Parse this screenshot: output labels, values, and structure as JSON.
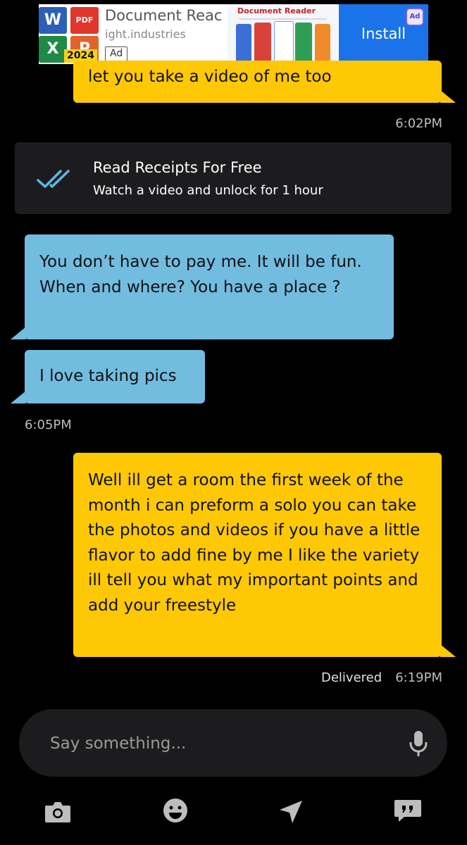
{
  "ad": {
    "title": "Document Reac",
    "domain": "ight.industries",
    "year_badge": "2024",
    "ad_label": "Ad",
    "screenshot_title": "Document Reader",
    "install_label": "Install",
    "badge_text": "Ad",
    "tile_labels": [
      "W",
      "PDF",
      "X",
      "P"
    ]
  },
  "messages": {
    "m1_text": "let you take a video of me too",
    "m1_time": "6:02PM",
    "m2_text": "You don’t have to pay me. It will be fun. When and where? You have a place ?",
    "m3_text": "I love taking pics",
    "m3_time": "6:05PM",
    "m4_text": "Well ill get a room the first week of the month i can preform a solo you can take the photos and videos if you have a little flavor to add fine by me I like the variety ill tell you what my important points and add your freestyle",
    "m4_status": "Delivered",
    "m4_time": "6:19PM"
  },
  "receipts_card": {
    "title": "Read Receipts For Free",
    "subtitle": "Watch a video and unlock for 1 hour",
    "icon": "double-check-icon"
  },
  "composer": {
    "placeholder": "Say something..."
  },
  "toolbar_icons": [
    "camera-icon",
    "emoji-icon",
    "location-icon",
    "phrases-icon"
  ],
  "colors": {
    "outgoing_bubble": "#fec804",
    "incoming_bubble": "#72bce0",
    "background": "#000000",
    "card": "#1c1c1e"
  }
}
